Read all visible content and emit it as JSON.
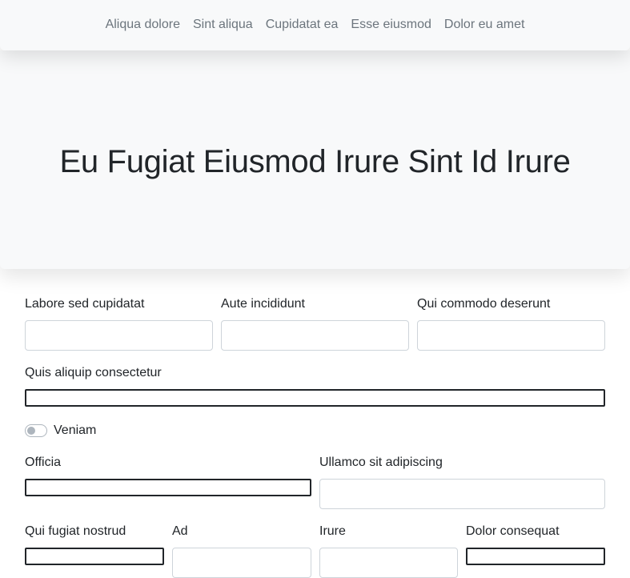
{
  "nav": {
    "links": [
      "Aliqua dolore",
      "Sint aliqua",
      "Cupidatat ea",
      "Esse eiusmod",
      "Dolor eu amet"
    ]
  },
  "hero": {
    "title": "Eu Fugiat Eiusmod Irure Sint Id Irure"
  },
  "form": {
    "row1": [
      "Labore sed cupidatat",
      "Aute incididunt",
      "Qui commodo deserunt"
    ],
    "row2": "Quis aliquip consectetur",
    "toggle_label": "Veniam",
    "row3": [
      "Officia",
      "Ullamco sit adipiscing"
    ],
    "row4": [
      "Qui fugiat nostrud",
      "Ad",
      "Irure",
      "Dolor consequat"
    ]
  }
}
